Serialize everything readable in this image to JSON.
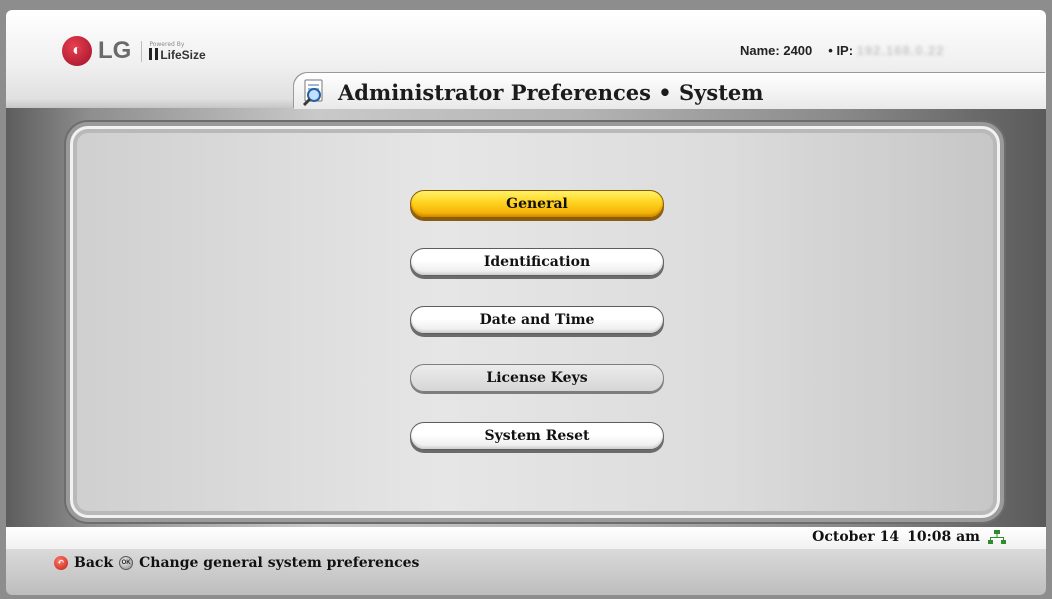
{
  "header": {
    "brand": "LG",
    "powered_by": "Powered By",
    "partner": "LifeSize",
    "name_label": "Name: 2400",
    "ip_label": "• IP:",
    "ip_value": "192.168.0.22",
    "title": "Administrator Preferences • System"
  },
  "menu": {
    "items": [
      {
        "label": "General",
        "state": "selected"
      },
      {
        "label": "Identification",
        "state": "normal"
      },
      {
        "label": "Date and Time",
        "state": "normal"
      },
      {
        "label": "License Keys",
        "state": "disabled"
      },
      {
        "label": "System Reset",
        "state": "normal"
      }
    ]
  },
  "status": {
    "date": "October 14",
    "time": "10:08 am"
  },
  "footer": {
    "back_label": "Back",
    "ok_glyph": "OK",
    "hint": "Change general system preferences"
  },
  "colors": {
    "selected": "#ffd31f",
    "brand_red": "#c8102e"
  }
}
